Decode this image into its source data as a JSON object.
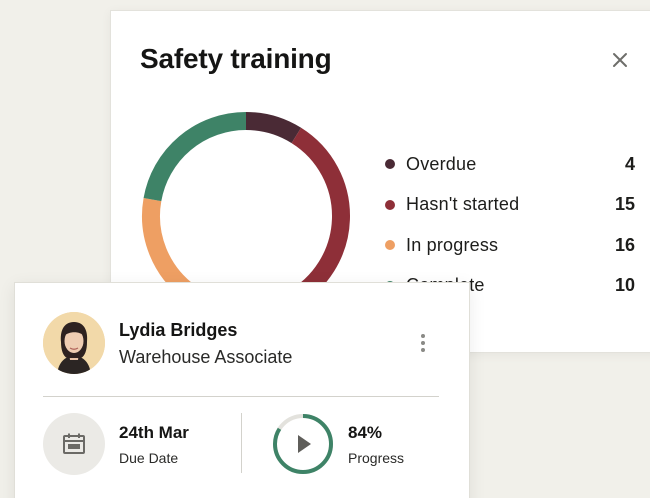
{
  "training": {
    "title": "Safety training",
    "close_icon": "close-icon",
    "chart_data": {
      "type": "pie",
      "donut": true,
      "categories": [
        "Overdue",
        "Hasn't started",
        "In progress",
        "Complete"
      ],
      "values": [
        4,
        15,
        16,
        10
      ],
      "colors": [
        "#4a2a35",
        "#8e2f38",
        "#ee9f63",
        "#3e8367"
      ]
    },
    "legend": [
      {
        "label": "Overdue",
        "count": "4",
        "color": "#4a2a35"
      },
      {
        "label": "Hasn't started",
        "count": "15",
        "color": "#8e2f38"
      },
      {
        "label": "In progress",
        "count": "16",
        "color": "#ee9f63"
      },
      {
        "label": "Complete",
        "count": "10",
        "color": "#3e8367"
      }
    ]
  },
  "profile": {
    "name": "Lydia Bridges",
    "role": "Warehouse Associate",
    "more_icon": "more-vertical-icon",
    "due": {
      "value": "24th Mar",
      "label": "Due Date",
      "icon": "calendar-icon"
    },
    "progress": {
      "value": "84%",
      "label": "Progress",
      "fraction": 0.84,
      "icon": "play-icon",
      "ring_color": "#3e8367"
    }
  }
}
